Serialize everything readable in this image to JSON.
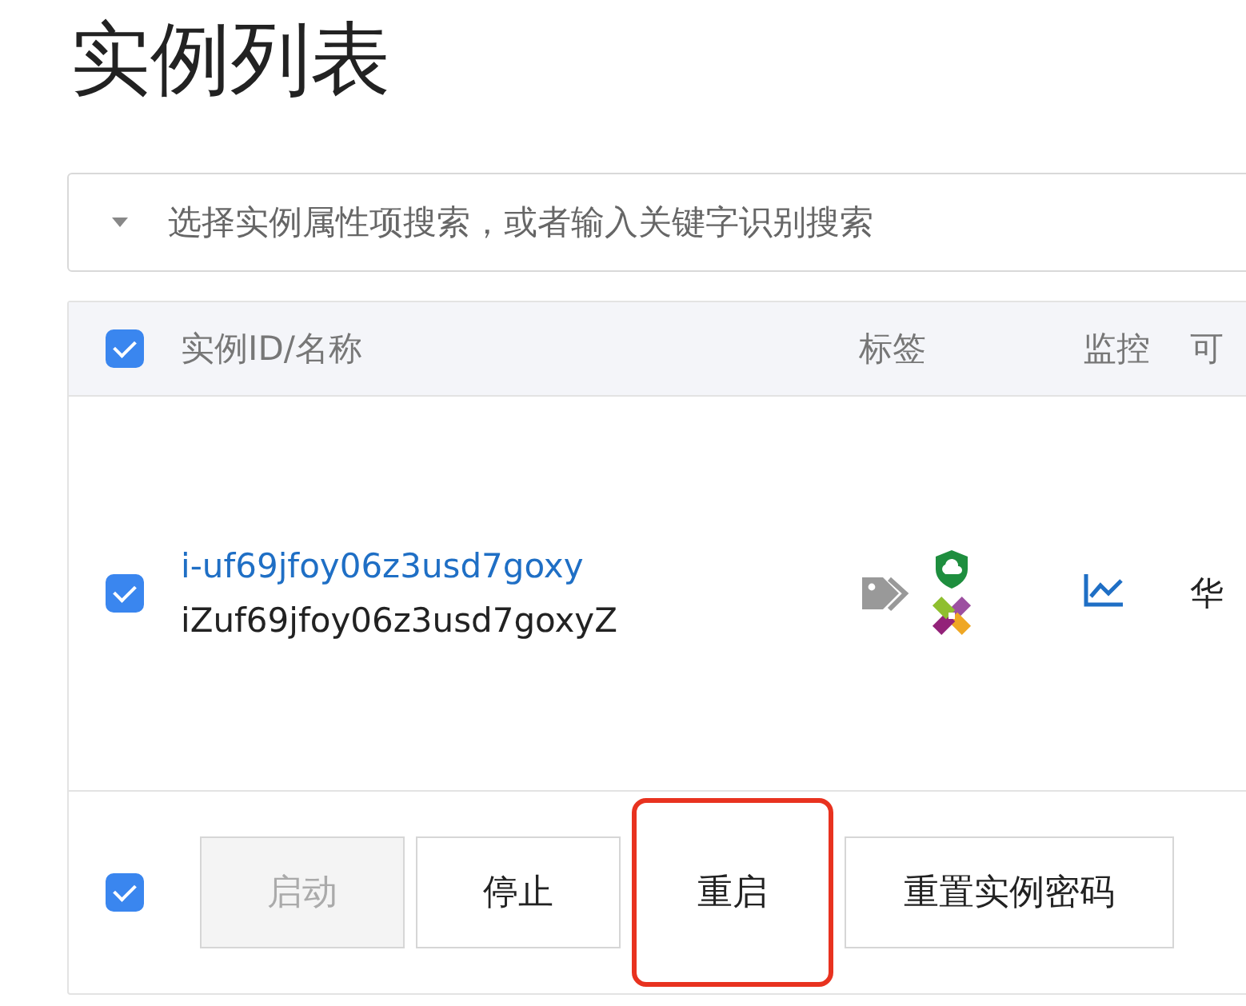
{
  "page": {
    "title": "实例列表"
  },
  "search": {
    "placeholder": "选择实例属性项搜索，或者输入关键字识别搜索"
  },
  "table": {
    "select_all_checked": true,
    "columns": [
      "实例ID/名称",
      "标签",
      "监控",
      "可"
    ],
    "rows": [
      {
        "checked": true,
        "id": "i-uf69jfoy06z3usd7goxy",
        "name": "iZuf69jfoy06z3usd7goxyZ",
        "column_4": "华"
      }
    ]
  },
  "actions": {
    "checked": true,
    "buttons": [
      {
        "label": "启动",
        "disabled": true,
        "highlighted": false
      },
      {
        "label": "停止",
        "disabled": false,
        "highlighted": false
      },
      {
        "label": "重启",
        "disabled": false,
        "highlighted": true
      },
      {
        "label": "重置实例密码",
        "disabled": false,
        "highlighted": false
      }
    ]
  }
}
